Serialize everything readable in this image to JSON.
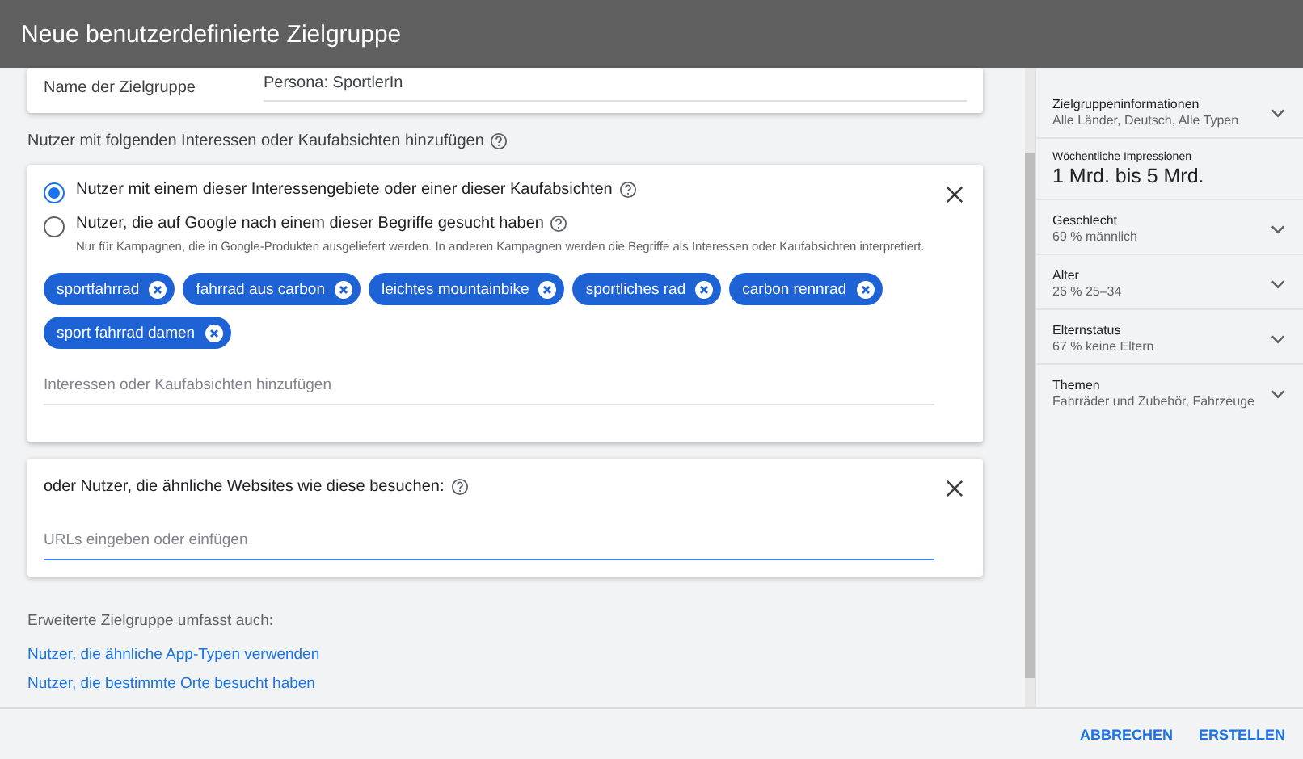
{
  "window": {
    "title": "Neue benutzerdefinierte Zielgruppe"
  },
  "name_field": {
    "label": "Name der Zielgruppe",
    "value": "Persona: SportlerIn"
  },
  "interests_heading": "Nutzer mit folgenden Interessen oder Kaufabsichten hinzufügen",
  "interests_card": {
    "options": [
      {
        "label": "Nutzer mit einem dieser Interessengebiete oder einer dieser Kaufabsichten",
        "selected": true
      },
      {
        "label": "Nutzer, die auf Google nach einem dieser Begriffe gesucht haben",
        "selected": false,
        "note": "Nur für Kampagnen, die in Google-Produkten ausgeliefert werden. In anderen Kampagnen werden die Begriffe als Interessen oder Kaufabsichten interpretiert."
      }
    ],
    "chips": [
      "sportfahrrad",
      "fahrrad aus carbon",
      "leichtes mountainbike",
      "sportliches rad",
      "carbon rennrad",
      "sport fahrrad damen"
    ],
    "placeholder": "Interessen oder Kaufabsichten hinzufügen"
  },
  "websites_card": {
    "label": "oder Nutzer, die ähnliche Websites wie diese besuchen:",
    "placeholder": "URLs eingeben oder einfügen"
  },
  "expanded_heading": "Erweiterte Zielgruppe umfasst auch:",
  "links": [
    "Nutzer, die ähnliche App-Typen verwenden",
    "Nutzer, die bestimmte Orte besucht haben"
  ],
  "sidebar": {
    "items": [
      {
        "kind": "expandable",
        "title": "Zielgruppeninformationen",
        "value": "Alle Länder, Deutsch, Alle Typen",
        "expanded": false
      },
      {
        "kind": "stat",
        "title": "Wöchentliche Impressionen",
        "value": "1 Mrd. bis 5 Mrd."
      },
      {
        "kind": "expandable",
        "title": "Geschlecht",
        "value": "69 % männlich",
        "expanded": false
      },
      {
        "kind": "expandable",
        "title": "Alter",
        "value": "26 % 25–34",
        "expanded": false
      },
      {
        "kind": "expandable",
        "title": "Elternstatus",
        "value": "67 % keine Eltern",
        "expanded": false
      },
      {
        "kind": "expandable",
        "title": "Themen",
        "value": "Fahrräder und Zubehör, Fahrzeuge",
        "expanded": false
      }
    ]
  },
  "buttons": [
    "ABBRECHEN",
    "ERSTELLEN"
  ]
}
